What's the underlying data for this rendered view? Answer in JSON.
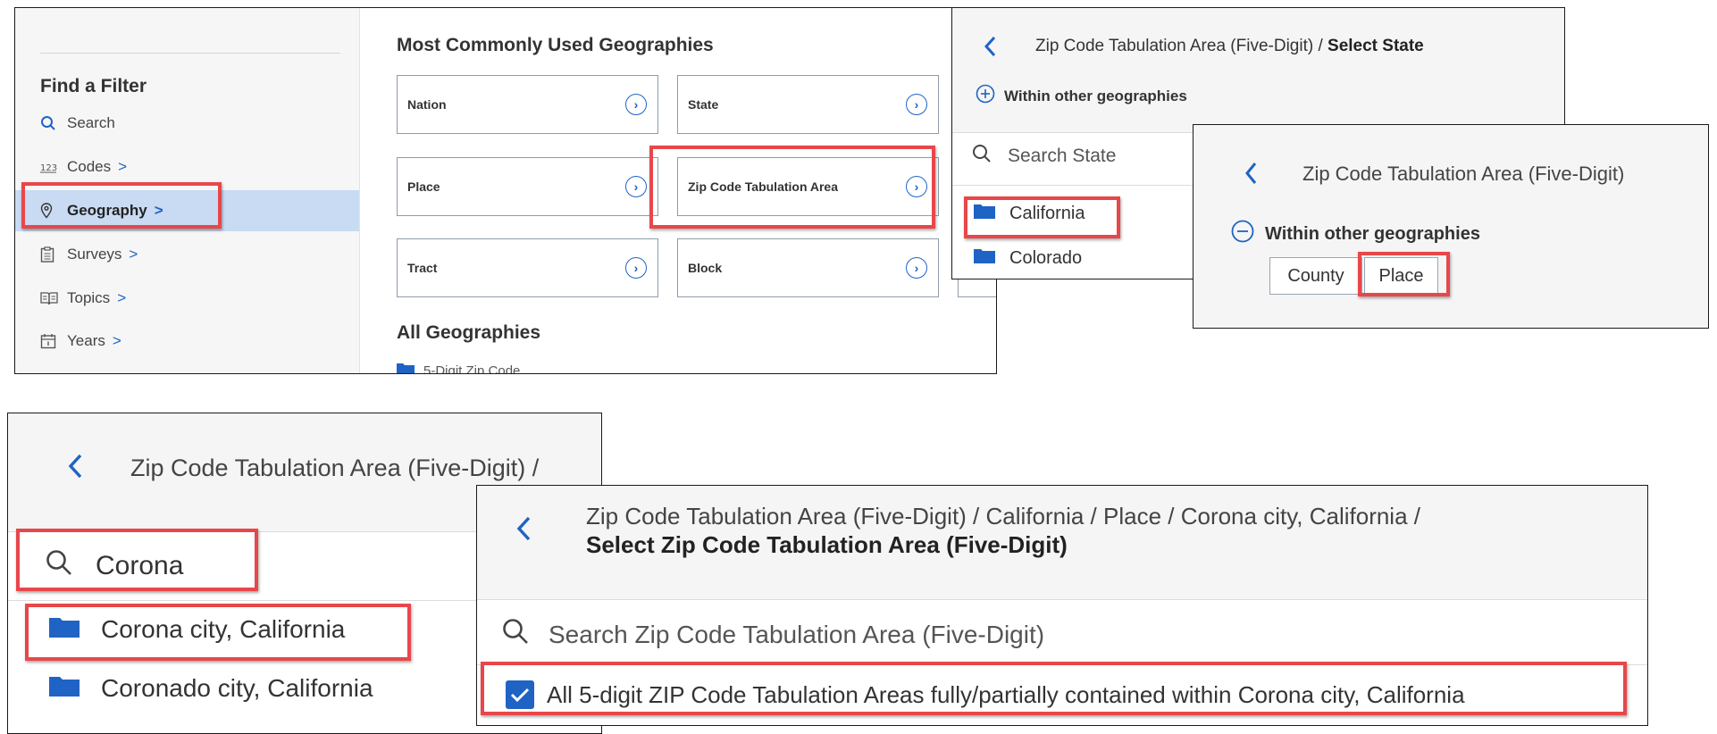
{
  "panel1": {
    "sidebar": {
      "title": "Find a Filter",
      "search_label": "Search",
      "items": [
        {
          "label": "Codes",
          "icon": "codes-123-icon"
        },
        {
          "label": "Geography",
          "icon": "map-pin-icon",
          "active": true
        },
        {
          "label": "Surveys",
          "icon": "clipboard-icon"
        },
        {
          "label": "Topics",
          "icon": "book-icon"
        },
        {
          "label": "Years",
          "icon": "calendar-icon"
        }
      ],
      "chevron": ">"
    },
    "main": {
      "heading": "Most Commonly Used Geographies",
      "cards": [
        "Nation",
        "State",
        "Place",
        "Zip Code Tabulation Area",
        "Tract",
        "Block"
      ],
      "all_heading": "All Geographies",
      "all_first_item": "5-Digit Zip Code"
    }
  },
  "panel2": {
    "breadcrumb_prefix": "Zip Code Tabulation Area (Five-Digit) / ",
    "breadcrumb_current": "Select State",
    "within_label": "Within other geographies",
    "search_placeholder": "Search State",
    "list": [
      "California",
      "Colorado"
    ]
  },
  "panel3": {
    "breadcrumb": "Zip Code Tabulation Area (Five-Digit)",
    "within_label": "Within other geographies",
    "chips": [
      "County",
      "Place"
    ]
  },
  "panel4": {
    "breadcrumb": "Zip Code Tabulation Area (Five-Digit) /",
    "search_value": "Corona",
    "list": [
      "Corona city, California",
      "Coronado city, California"
    ]
  },
  "panel5": {
    "breadcrumb_line1": "Zip Code Tabulation Area (Five-Digit) / California / Place / Corona city, California /",
    "breadcrumb_line2": "Select Zip Code Tabulation Area (Five-Digit)",
    "search_placeholder": "Search Zip Code Tabulation Area (Five-Digit)",
    "checkbox_label": "All 5-digit ZIP Code Tabulation Areas fully/partially contained within Corona city, California",
    "checked": true
  },
  "colors": {
    "accent": "#1f63c4",
    "highlight": "#e8474a",
    "active_bg": "#c9dbf2"
  }
}
